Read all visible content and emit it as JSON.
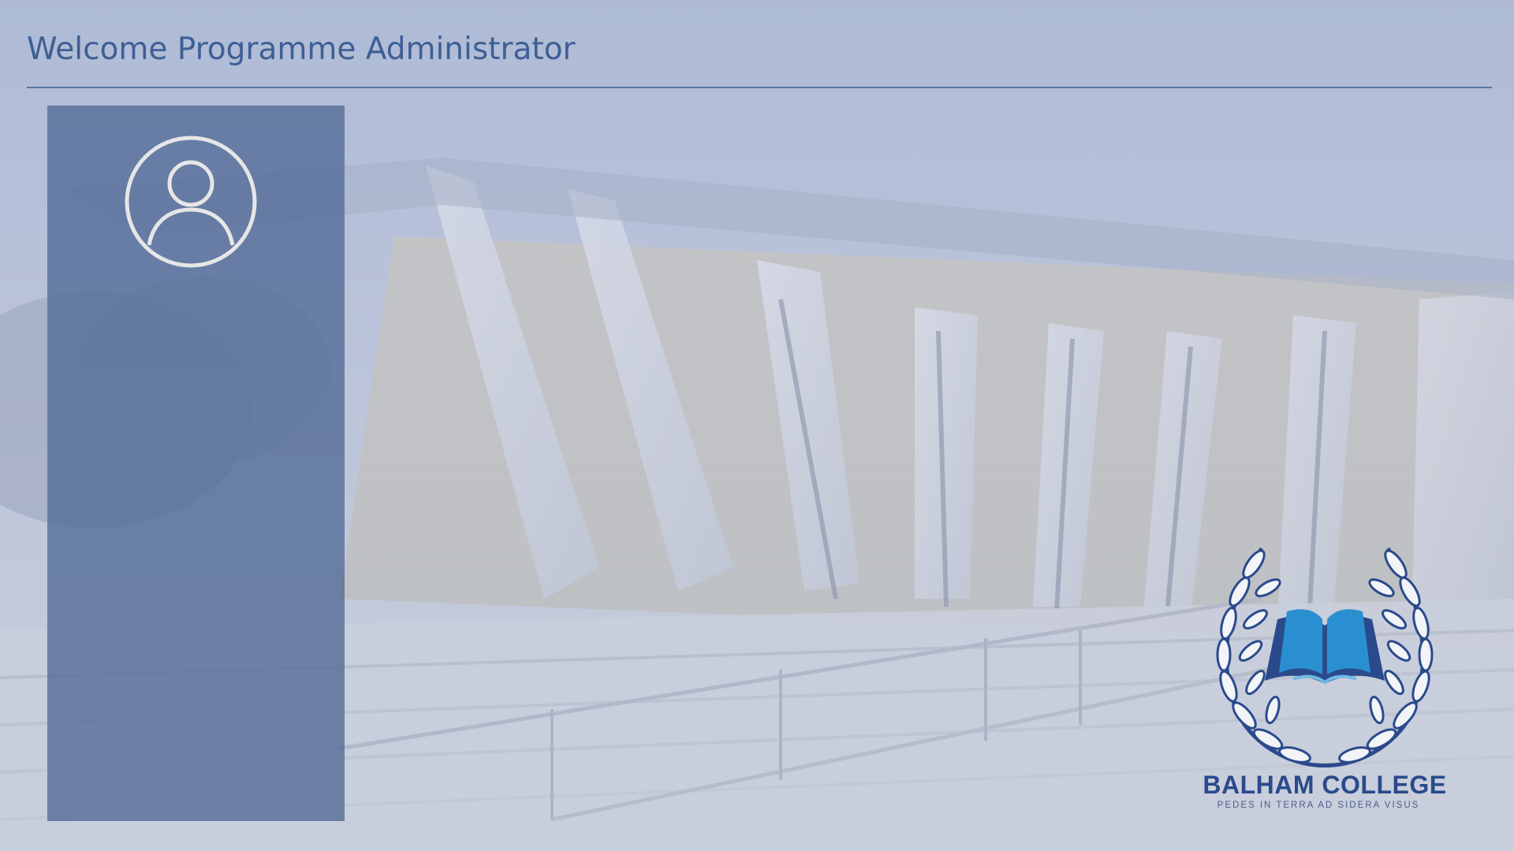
{
  "header": {
    "title": "Welcome Programme Administrator"
  },
  "side_panel": {
    "avatar_icon": "user-circle-icon"
  },
  "logo": {
    "name": "BALHAM COLLEGE",
    "motto": "PEDES IN TERRA AD SIDERA VISUS",
    "icon": "laurel-book-icon",
    "colors": {
      "brand_dark": "#2a4a8c",
      "book_blue": "#2a8fd0"
    }
  },
  "colors": {
    "header_text": "#3e5f94",
    "panel": "#526a96",
    "avatar_stroke": "#e6e6e6"
  }
}
